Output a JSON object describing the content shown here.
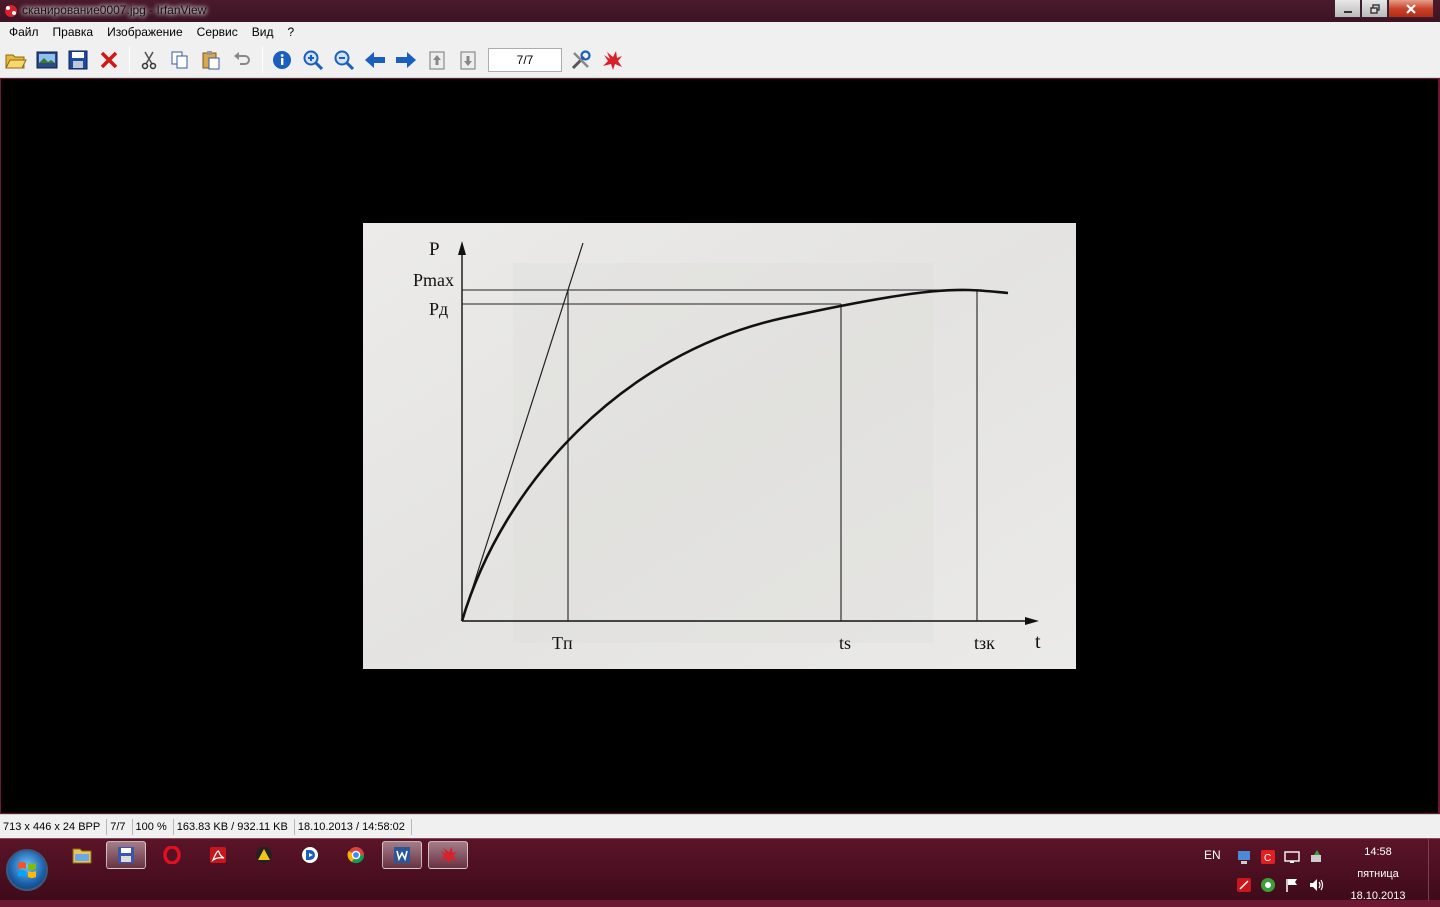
{
  "window": {
    "title": "сканирование0007.jpg - IrfanView",
    "controls": [
      "minimize",
      "maximize",
      "close"
    ]
  },
  "menu": {
    "items": [
      "Файл",
      "Правка",
      "Изображение",
      "Сервис",
      "Вид",
      "?"
    ]
  },
  "toolbar": {
    "buttons": [
      "open-icon",
      "thumbnails-icon",
      "save-icon",
      "delete-icon",
      "cut-icon",
      "copy-icon",
      "paste-icon",
      "undo-icon",
      "info-icon",
      "zoom-in-icon",
      "zoom-out-icon",
      "previous-icon",
      "next-icon",
      "page-up-icon",
      "page-down-icon"
    ],
    "page_value": "7/7",
    "extra_buttons": [
      "properties-icon",
      "irfanview-icon"
    ]
  },
  "image": {
    "labels": {
      "y_axis": "P",
      "pmax": "Pmax",
      "pd": "Pд",
      "tp": "Tп",
      "ts": "ts",
      "tsk": "tзк",
      "x_axis": "t"
    }
  },
  "status": {
    "dimensions": "713 x 446 x 24 BPP",
    "page": "7/7",
    "zoom": "100 %",
    "size": "163.83 KB / 932.11 KB",
    "datetime": "18.10.2013 / 14:58:02"
  },
  "taskbar": {
    "apps": [
      "explorer-icon",
      "save-disk-icon",
      "opera-icon",
      "pdf-icon",
      "nero-icon",
      "daemon-icon",
      "chrome-icon",
      "word-icon",
      "irfanview-icon"
    ],
    "active_apps": [
      "save-disk-icon",
      "word-icon",
      "irfanview-icon"
    ],
    "language": "EN",
    "clock_time": "14:58",
    "clock_day": "пятница",
    "clock_date": "18.10.2013"
  }
}
